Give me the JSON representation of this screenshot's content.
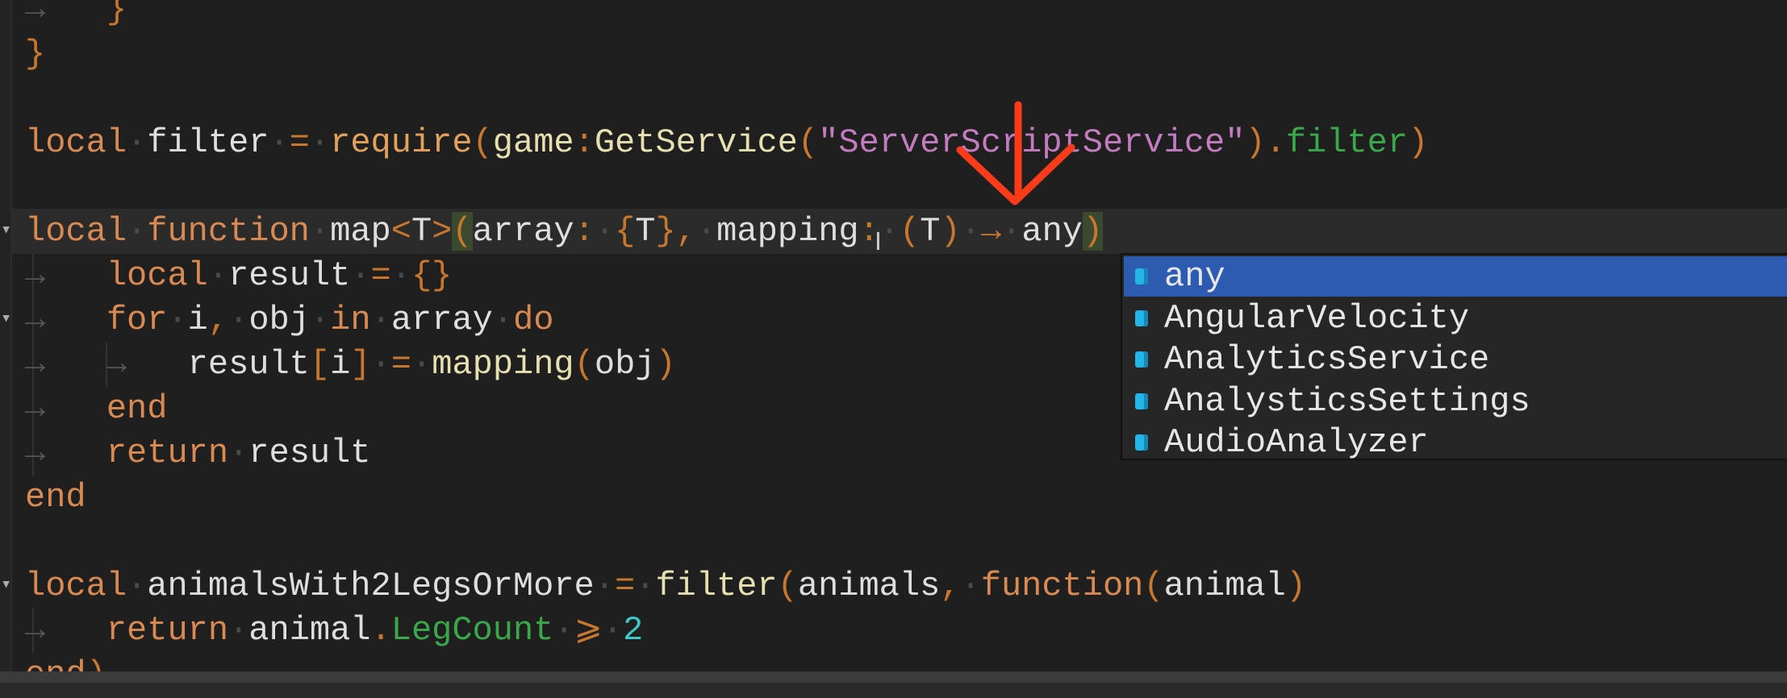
{
  "editor": {
    "lines": [
      [
        [
          "→   ",
          "ind"
        ],
        [
          "}",
          "br"
        ]
      ],
      [
        [
          "}",
          "br"
        ]
      ],
      [],
      [
        [
          "local",
          "kw"
        ],
        [
          "·",
          "ws"
        ],
        [
          "filter",
          "id"
        ],
        [
          "·",
          "ws"
        ],
        [
          "=",
          "op"
        ],
        [
          "·",
          "ws"
        ],
        [
          "require",
          "fn2"
        ],
        [
          "(",
          "br"
        ],
        [
          "game",
          "cream"
        ],
        [
          ":",
          "op"
        ],
        [
          "GetService",
          "fn"
        ],
        [
          "(",
          "br"
        ],
        [
          "\"ServerScriptService\"",
          "str"
        ],
        [
          ")",
          "br"
        ],
        [
          ".",
          "op"
        ],
        [
          "filter",
          "grn"
        ],
        [
          ")",
          "br"
        ]
      ],
      [],
      [
        [
          "local",
          "kw"
        ],
        [
          "·",
          "ws"
        ],
        [
          "function",
          "kw"
        ],
        [
          "·",
          "ws"
        ],
        [
          "map",
          "id"
        ],
        [
          "<",
          "op"
        ],
        [
          "T",
          "id"
        ],
        [
          ">",
          "op"
        ],
        [
          "(",
          "br match"
        ],
        [
          "array",
          "id"
        ],
        [
          ":",
          "op"
        ],
        [
          "·",
          "ws"
        ],
        [
          "{",
          "br"
        ],
        [
          "T",
          "id"
        ],
        [
          "}",
          "br"
        ],
        [
          ",",
          "op"
        ],
        [
          "·",
          "ws"
        ],
        [
          "mapping",
          "id"
        ],
        [
          ":",
          "op"
        ],
        [
          "·",
          "ws"
        ],
        [
          "(",
          "br"
        ],
        [
          "T",
          "id"
        ],
        [
          ")",
          "br"
        ],
        [
          "·",
          "ws"
        ],
        [
          "→",
          "op"
        ],
        [
          "·",
          "ws"
        ],
        [
          "any",
          "id"
        ],
        [
          ")",
          "br match"
        ]
      ],
      [
        [
          "→   ",
          "ind"
        ],
        [
          "local",
          "kw"
        ],
        [
          "·",
          "ws"
        ],
        [
          "result",
          "id"
        ],
        [
          "·",
          "ws"
        ],
        [
          "=",
          "op"
        ],
        [
          "·",
          "ws"
        ],
        [
          "{}",
          "br"
        ]
      ],
      [
        [
          "→   ",
          "ind"
        ],
        [
          "for",
          "kw"
        ],
        [
          "·",
          "ws"
        ],
        [
          "i",
          "id"
        ],
        [
          ",",
          "op"
        ],
        [
          "·",
          "ws"
        ],
        [
          "obj",
          "id"
        ],
        [
          "·",
          "ws"
        ],
        [
          "in",
          "kw"
        ],
        [
          "·",
          "ws"
        ],
        [
          "array",
          "id"
        ],
        [
          "·",
          "ws"
        ],
        [
          "do",
          "kw"
        ]
      ],
      [
        [
          "→   ",
          "ind"
        ],
        [
          "→   ",
          "ind"
        ],
        [
          "result",
          "id"
        ],
        [
          "[",
          "br"
        ],
        [
          "i",
          "id"
        ],
        [
          "]",
          "br"
        ],
        [
          "·",
          "ws"
        ],
        [
          "=",
          "op"
        ],
        [
          "·",
          "ws"
        ],
        [
          "mapping",
          "fn"
        ],
        [
          "(",
          "br"
        ],
        [
          "obj",
          "id"
        ],
        [
          ")",
          "br"
        ]
      ],
      [
        [
          "→   ",
          "ind"
        ],
        [
          "end",
          "kw"
        ]
      ],
      [
        [
          "→   ",
          "ind"
        ],
        [
          "return",
          "kw"
        ],
        [
          "·",
          "ws"
        ],
        [
          "result",
          "id"
        ]
      ],
      [
        [
          "end",
          "kw"
        ]
      ],
      [],
      [
        [
          "local",
          "kw"
        ],
        [
          "·",
          "ws"
        ],
        [
          "animalsWith2LegsOrMore",
          "id"
        ],
        [
          "·",
          "ws"
        ],
        [
          "=",
          "op"
        ],
        [
          "·",
          "ws"
        ],
        [
          "filter",
          "fn"
        ],
        [
          "(",
          "br"
        ],
        [
          "animals",
          "id"
        ],
        [
          ",",
          "op"
        ],
        [
          "·",
          "ws"
        ],
        [
          "function",
          "kw"
        ],
        [
          "(",
          "br"
        ],
        [
          "animal",
          "id"
        ],
        [
          ")",
          "br"
        ]
      ],
      [
        [
          "→   ",
          "ind"
        ],
        [
          "return",
          "kw"
        ],
        [
          "·",
          "ws"
        ],
        [
          "animal",
          "id"
        ],
        [
          ".",
          "op"
        ],
        [
          "LegCount",
          "grn"
        ],
        [
          "·",
          "ws"
        ],
        [
          "⩾",
          "op"
        ],
        [
          "·",
          "ws"
        ],
        [
          "2",
          "num"
        ]
      ],
      [
        [
          "end",
          "kw"
        ],
        [
          ")",
          "br"
        ]
      ]
    ],
    "fold_marker_lines": [
      5,
      7,
      13
    ],
    "fold_icon": "chevron-down-icon",
    "current_line": 5
  },
  "autocomplete": {
    "item_icon": "class-cube-icon",
    "selected_index": 0,
    "items": [
      "any",
      "AngularVelocity",
      "AnalyticsService",
      "AnalysticsSettings",
      "AudioAnalyzer"
    ]
  },
  "colors": {
    "keyword": "#d98a52",
    "string": "#c47cc0",
    "selection": "#2c5bb0",
    "annotation": "#ff3b1a"
  }
}
